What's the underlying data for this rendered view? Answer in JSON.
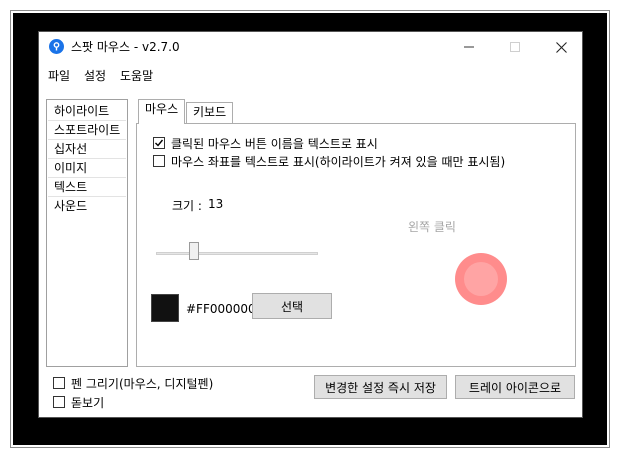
{
  "window": {
    "title": "스팟 마우스 - v2.7.0",
    "app_icon_glyph": "୧"
  },
  "menu": [
    "파일",
    "설정",
    "도움말"
  ],
  "left_list": {
    "items": [
      "하이라이트",
      "스포트라이트",
      "십자선",
      "이미지",
      "텍스트",
      "사운드"
    ],
    "selected": "텍스트"
  },
  "tabs": {
    "items": [
      "마우스",
      "키보드"
    ],
    "active": "마우스"
  },
  "options": {
    "show_click_name": {
      "label": "클릭된 마우스 버튼 이름을 텍스트로 표시",
      "checked": true
    },
    "show_coords": {
      "label": "마우스 좌표를 텍스트로 표시(하이라이트가 켜져 있을 때만 표시됨)",
      "checked": false
    }
  },
  "size": {
    "label": "크기 :",
    "value": "13",
    "level": 0.22
  },
  "preview": {
    "text": "왼쪽 클릭",
    "circle_color": "#ff8080"
  },
  "color": {
    "hex": "#FF000000",
    "swatch_color": "#111111",
    "select_button": "선택"
  },
  "footer": {
    "pen_label": "펜 그리기(마우스, 디지털펜)",
    "pen_checked": false,
    "magnifier_label": "돋보기",
    "magnifier_checked": false,
    "save_button": "변경한 설정 즉시 저장",
    "tray_button": "트레이 아이콘으로"
  }
}
